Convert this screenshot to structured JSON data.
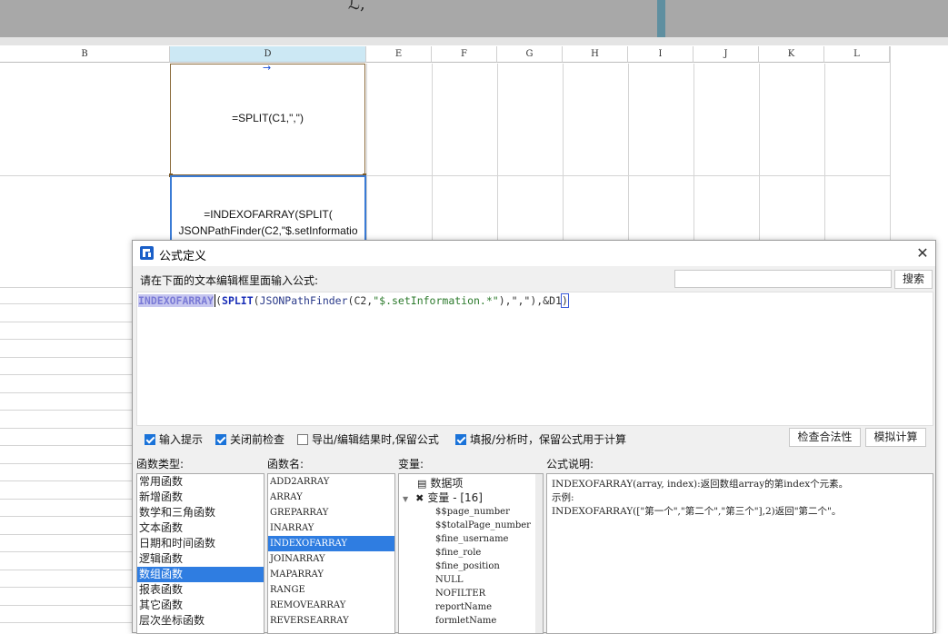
{
  "sheet": {
    "columns": [
      "B",
      "D",
      "E",
      "F",
      "G",
      "H",
      "I",
      "J",
      "K",
      "L"
    ],
    "selected_column": "D",
    "cells": {
      "d1": "=SPLIT(C1,\",\")",
      "d2_line1": "=INDEXOFARRAY(SPLIT(",
      "d2_line2": "JSONPathFinder(C2,\"$.setInformatio"
    }
  },
  "dialog": {
    "title": "公式定义",
    "close_label": "✕",
    "prompt": "请在下面的文本编辑框里面输入公式:",
    "search": {
      "placeholder": "",
      "button": "搜索"
    },
    "formula": {
      "fn1": "INDEXOFARRAY",
      "p1": "(",
      "fn2": "SPLIT",
      "p2": "(",
      "fn3": "JSONPathFinder",
      "p3": "(C2,",
      "str": "\"$.setInformation.*\"",
      "p4": "),\",\"),&D1",
      "p5": ")"
    },
    "options": [
      {
        "label": "输入提示",
        "checked": true
      },
      {
        "label": "关闭前检查",
        "checked": true
      },
      {
        "label": "导出/编辑结果时,保留公式",
        "checked": false
      },
      {
        "label": "填报/分析时，保留公式用于计算",
        "checked": true
      }
    ],
    "buttons": {
      "validate": "检查合法性",
      "simulate": "模拟计算"
    },
    "sections": {
      "func_type": "函数类型:",
      "func_name": "函数名:",
      "variables": "变量:",
      "description": "公式说明:"
    },
    "func_types": [
      "常用函数",
      "新增函数",
      "数学和三角函数",
      "文本函数",
      "日期和时间函数",
      "逻辑函数",
      "数组函数",
      "报表函数",
      "其它函数",
      "层次坐标函数"
    ],
    "func_type_selected": 6,
    "func_names": [
      "ADD2ARRAY",
      "ARRAY",
      "GREPARRAY",
      "INARRAY",
      "INDEXOFARRAY",
      "JOINARRAY",
      "MAPARRAY",
      "RANGE",
      "REMOVEARRAY",
      "REVERSEARRAY"
    ],
    "func_name_selected": 4,
    "variables": {
      "data_item": "数据项",
      "var_group": "变量 - [16]",
      "items": [
        "$$page_number",
        "$$totalPage_number",
        "$fine_username",
        "$fine_role",
        "$fine_position",
        "NULL",
        "NOFILTER",
        "reportName",
        "formletName"
      ]
    },
    "description": {
      "line1": "INDEXOFARRAY(array, index):返回数组array的第index个元素。",
      "line2": "示例:",
      "line3": "INDEXOFARRAY([\"第一个\",\"第二个\",\"第三个\"],2)返回\"第二个\"。"
    }
  }
}
